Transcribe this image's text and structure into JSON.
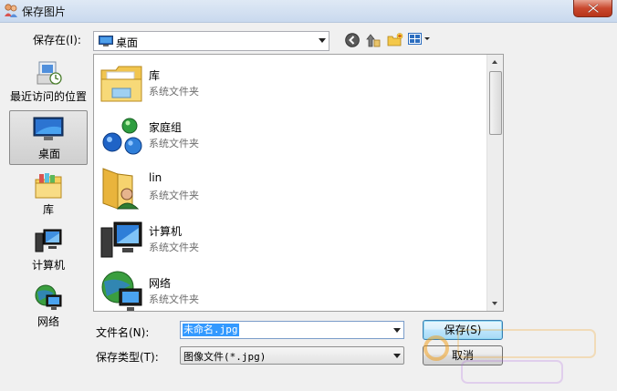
{
  "window": {
    "title": "保存图片",
    "title_icon": "people-icon",
    "close_icon": "close-icon"
  },
  "save_in": {
    "label": "保存在(I):",
    "value": "桌面",
    "value_icon": "desktop-icon"
  },
  "toolbar": {
    "icons": [
      "back-icon",
      "up-folder-icon",
      "new-folder-icon",
      "view-menu-icon"
    ]
  },
  "places": [
    {
      "label": "最近访问的位置",
      "icon": "recent-places-icon",
      "selected": false
    },
    {
      "label": "桌面",
      "icon": "desktop-icon",
      "selected": true
    },
    {
      "label": "库",
      "icon": "libraries-icon",
      "selected": false
    },
    {
      "label": "计算机",
      "icon": "computer-icon",
      "selected": false
    },
    {
      "label": "网络",
      "icon": "network-icon",
      "selected": false
    }
  ],
  "files": [
    {
      "name": "库",
      "type": "系统文件夹",
      "icon": "libraries-folder-icon"
    },
    {
      "name": "家庭组",
      "type": "系统文件夹",
      "icon": "homegroup-icon"
    },
    {
      "name": "lin",
      "type": "系统文件夹",
      "icon": "user-folder-icon"
    },
    {
      "name": "计算机",
      "type": "系统文件夹",
      "icon": "computer-icon"
    },
    {
      "name": "网络",
      "type": "系统文件夹",
      "icon": "network-icon"
    }
  ],
  "filename": {
    "label": "文件名(N):",
    "value": "未命名.jpg"
  },
  "filetype": {
    "label": "保存类型(T):",
    "value": "图像文件(*.jpg)"
  },
  "buttons": {
    "save": "保存(S)",
    "cancel": "取消"
  },
  "colors": {
    "selection": "#3399ff",
    "default_button_border": "#3c7fb1"
  }
}
